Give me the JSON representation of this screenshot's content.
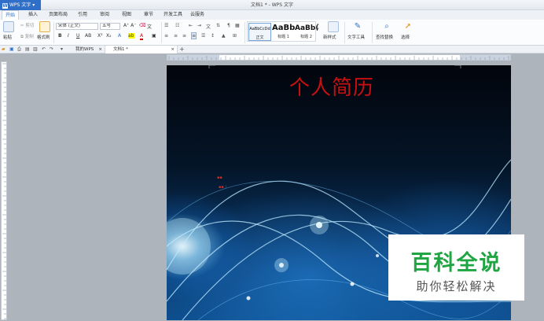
{
  "app": {
    "name": "WPS 文字"
  },
  "window": {
    "title": "文档1 * - WPS 文字"
  },
  "menu_tabs": [
    "开始",
    "插入",
    "页面布局",
    "引用",
    "审阅",
    "视图",
    "章节",
    "开发工具",
    "云服务"
  ],
  "ribbon": {
    "paste": "粘贴",
    "cut": "剪切",
    "copy": "复制",
    "format_painter": "格式刷",
    "font_name": "宋体 (正文)",
    "font_size": "五号",
    "styles": [
      {
        "sample": "AaBbCcDd",
        "name": "正文"
      },
      {
        "sample": "AaBb",
        "name": "标题 1"
      },
      {
        "sample": "AaBb(",
        "name": "标题 2"
      }
    ],
    "new_style": "新样式",
    "text_tools": "文字工具",
    "find_replace": "查找替换",
    "select": "选择"
  },
  "doc_tabs": [
    "我的WPS",
    "文档1 *"
  ],
  "document": {
    "title": "个人简历"
  },
  "watermark": {
    "main": "百科全说",
    "sub": "助你轻松解决"
  },
  "colors": {
    "accent": "#2f6fc7",
    "title_red": "#c81010",
    "watermark_green": "#1fa542"
  }
}
